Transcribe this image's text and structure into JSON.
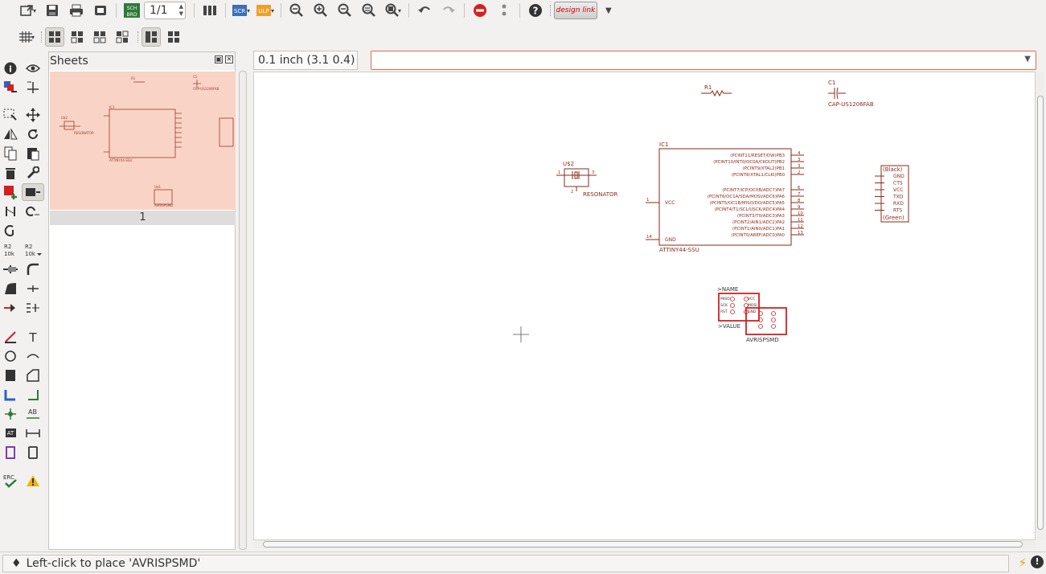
{
  "toolbar": {
    "page_value": "1/1",
    "sch_brd_label": "SCH\nBRD",
    "scr_label": "SCR",
    "ulp_label": "ULP",
    "designlink_label": "design link"
  },
  "sheets_panel": {
    "title": "Sheets",
    "sheet_label": "1"
  },
  "grid_readout": "0.1 inch (3.1 0.4)",
  "command_input": {
    "value": "",
    "placeholder": ""
  },
  "status_message": "Left-click to place 'AVRISPSMD'",
  "schematic": {
    "r1": {
      "name": "R1"
    },
    "c1": {
      "name": "C1",
      "value": "CAP-US1206FAB"
    },
    "u2": {
      "name": "U$2",
      "value": "RESONATOR"
    },
    "ic1": {
      "name": "IC1",
      "value": "ATTINY44-SSU",
      "left_pins": [
        {
          "num": "1",
          "label": "VCC"
        },
        {
          "num": "14",
          "label": "GND"
        }
      ],
      "right_pins": [
        {
          "num": "4",
          "label": "(PCINT11/RESET/DW)PB3"
        },
        {
          "num": "3",
          "label": "(PCINT10/INT0/OC0A/CKOUT)PB2"
        },
        {
          "num": "3",
          "label": "(PCINT9/XTAL2)PB1"
        },
        {
          "num": "2",
          "label": "(PCINT8/XTAL1/CLKI)PB0"
        },
        {
          "num": "6",
          "label": "(PCINT7/ICP/OC0B/ADC7)PA7"
        },
        {
          "num": "7",
          "label": "(PCINT6/OC1A/SDA/MOSI/ADC6)PA6"
        },
        {
          "num": "8",
          "label": "(PCINT5/OC1B/MISO/DO/ADC5)PA5"
        },
        {
          "num": "9",
          "label": "(PCINT4/T1/SCL/USCK/ADC4)PA4"
        },
        {
          "num": "10",
          "label": "(PCINT3/T0/ADC3)PA3"
        },
        {
          "num": "11",
          "label": "(PCINT2/AIN1/ADC2)PA2"
        },
        {
          "num": "12",
          "label": "(PCINT1/AIN0/ADC1)PA1"
        },
        {
          "num": "13",
          "label": "(PCINT0/AREF/ADC0)PA0"
        }
      ]
    },
    "ftdi": {
      "top": "(Black)",
      "bottom": "(Green)",
      "pins": [
        "GND",
        "CTS",
        "VCC",
        "TXD",
        "RXD",
        "RTS"
      ]
    },
    "avrisp": {
      "name": ">NAME",
      "value_text": ">VALUE",
      "value": "AVRISPSMD",
      "pins_left": [
        "MISO",
        "SCK",
        "RST"
      ],
      "pins_right": [
        "VCC",
        "MOSI",
        "GND"
      ]
    }
  }
}
